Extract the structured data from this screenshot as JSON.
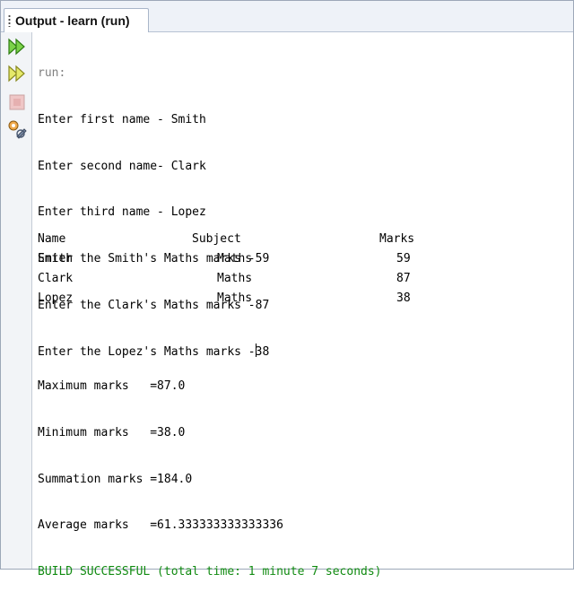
{
  "window": {
    "title": "Output - learn (run)"
  },
  "toolbar": {
    "buttons": [
      {
        "name": "rerun-button",
        "icon": "double-play-icon"
      },
      {
        "name": "rerun-with-params-button",
        "icon": "double-play-outline-icon"
      },
      {
        "name": "stop-button",
        "icon": "stop-icon"
      },
      {
        "name": "settings-button",
        "icon": "wrench-gear-icon"
      }
    ]
  },
  "console": {
    "run_label": "run:",
    "prompts": [
      "Enter first name - Smith",
      "Enter second name- Clark",
      "Enter third name - Lopez",
      "Enter the Smith's Maths marks -59",
      "Enter the Clark's Maths marks -87"
    ],
    "last_prompt_before_cursor": "Enter the Lopez's Maths marks -",
    "last_prompt_after_cursor": "38",
    "table": {
      "headers": [
        "Name",
        "Subject",
        "Marks"
      ],
      "rows": [
        [
          "Smith",
          "Maths",
          "59"
        ],
        [
          "Clark",
          "Maths",
          "87"
        ],
        [
          "Lopez",
          "Maths",
          "38"
        ]
      ]
    },
    "stats": [
      "Maximum marks   =87.0",
      "Minimum marks   =38.0",
      "Summation marks =184.0",
      "Average marks   =61.333333333333336"
    ],
    "build_message": "BUILD SUCCESSFUL (total time: 1 minute 7 seconds)"
  },
  "colors": {
    "success": "#118b11",
    "run_label": "#808080",
    "play_icon": "#3a9a1c"
  }
}
